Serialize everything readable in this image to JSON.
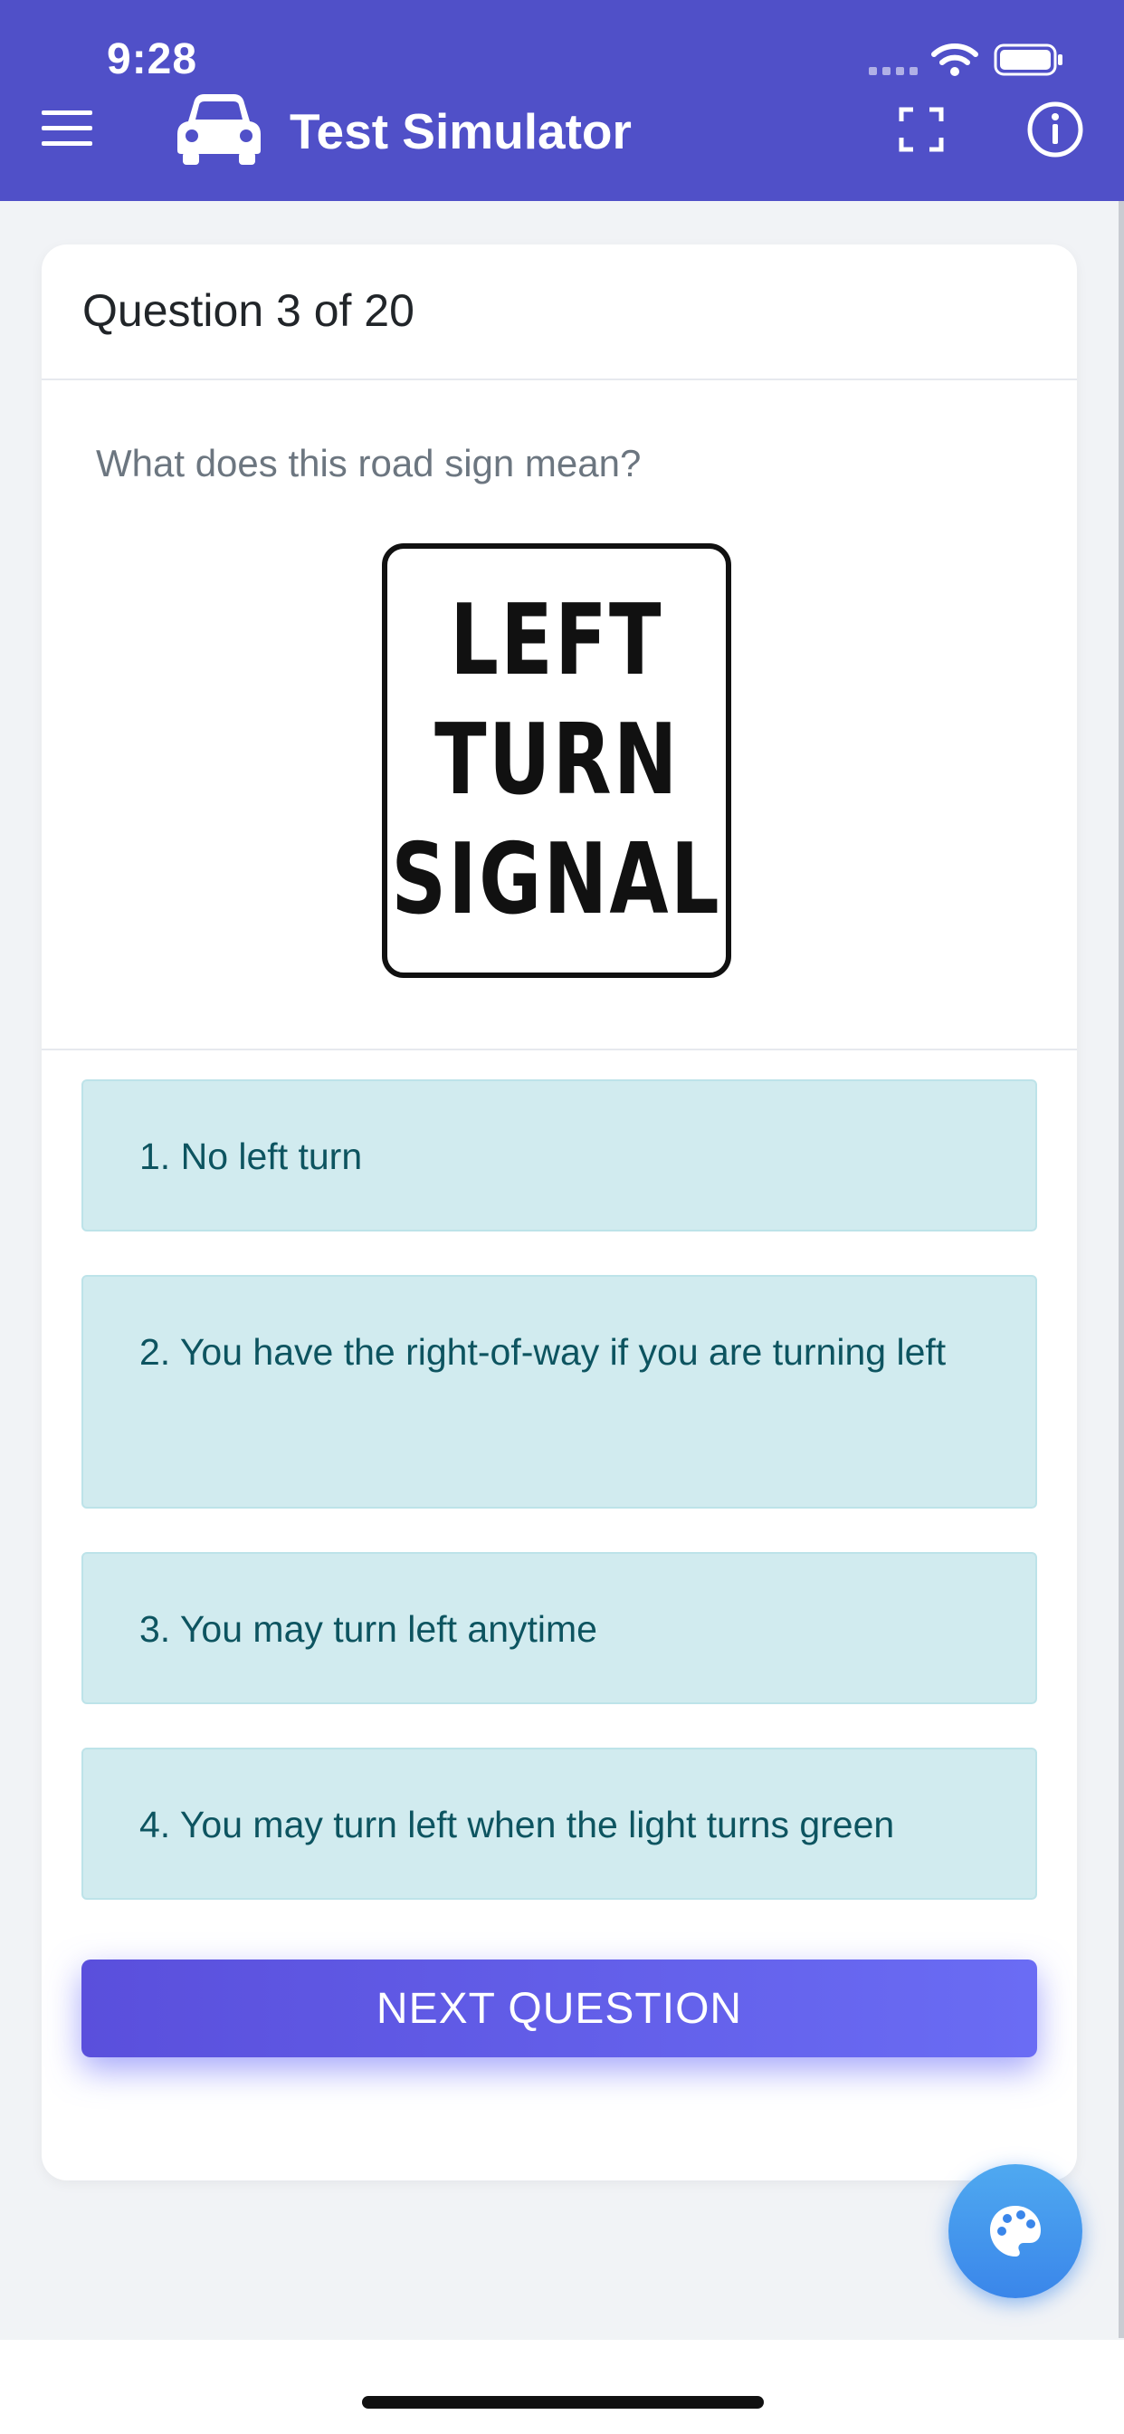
{
  "status_bar": {
    "time": "9:28"
  },
  "header": {
    "title": "Test Simulator",
    "menu_icon": "menu-icon",
    "logo_icon": "car-icon",
    "fullscreen_icon": "fullscreen-icon",
    "info_icon": "info-icon",
    "background_color": "#5050c8"
  },
  "quiz": {
    "progress_label": "Question 3 of 20",
    "question": "What does this road sign mean?",
    "sign_text": [
      "LEFT",
      "TURN",
      "SIGNAL"
    ],
    "answers": [
      {
        "label": "1. No left turn"
      },
      {
        "label": "2. You have the right-of-way if you are turning left"
      },
      {
        "label": "3. You may turn left anytime"
      },
      {
        "label": "4. You may turn left when the light turns green"
      }
    ],
    "next_button": "NEXT QUESTION",
    "answer_background": "#d1ebef",
    "answer_text_color": "#0d5460"
  },
  "fab": {
    "icon": "palette-icon",
    "color": "#3a86ea"
  }
}
